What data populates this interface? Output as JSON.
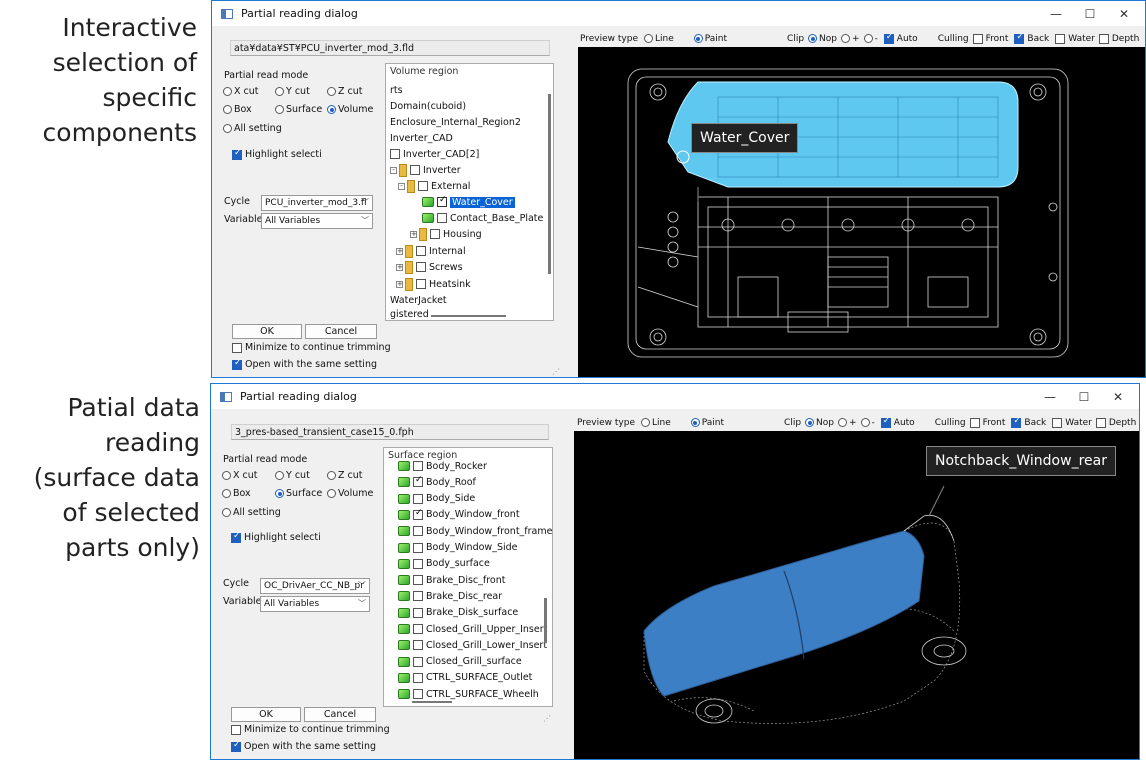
{
  "captions": {
    "top": "Interactive\nselection of\nspecific\ncomponents",
    "bottom": "Patial data\nreading\n(surface data\nof selected\nparts only)"
  },
  "window_controls": {
    "minimize": "—",
    "maximize": "☐",
    "close": "✕"
  },
  "dialog1": {
    "title": "Partial reading dialog",
    "file_path": "ata¥data¥ST¥PCU_inverter_mod_3.fld",
    "read_mode_label": "Partial read mode",
    "modes": [
      {
        "label": "X cut",
        "selected": false
      },
      {
        "label": "Y cut",
        "selected": false
      },
      {
        "label": "Z cut",
        "selected": false
      },
      {
        "label": "Box",
        "selected": false
      },
      {
        "label": "Surface",
        "selected": false
      },
      {
        "label": "Volume",
        "selected": true
      }
    ],
    "all_setting_label": "All setting",
    "highlight_label": "Highlight selecti",
    "cycle_label": "Cycle",
    "cycle_value": "PCU_inverter_mod_3.fl",
    "variable_label": "Variable",
    "variable_value": "All Variables",
    "tree_header": "Volume region",
    "tree_items": [
      {
        "label": "rts",
        "type": "text",
        "indent": 0,
        "checked": false
      },
      {
        "label": "Domain(cuboid)",
        "type": "text",
        "indent": 0,
        "checked": false
      },
      {
        "label": "Enclosure_Internal_Region2",
        "type": "text",
        "indent": 0,
        "checked": false
      },
      {
        "label": "Inverter_CAD",
        "type": "text",
        "indent": 0,
        "checked": false
      },
      {
        "label": "Inverter_CAD[2]",
        "type": "check",
        "indent": 0,
        "checked": false
      },
      {
        "label": "Inverter",
        "type": "folder",
        "indent": 1,
        "checked": false
      },
      {
        "label": "External",
        "type": "folder",
        "indent": 2,
        "checked": false
      },
      {
        "label": "Water_Cover",
        "type": "part",
        "indent": 3,
        "checked": true,
        "selected": true
      },
      {
        "label": "Contact_Base_Plate",
        "type": "part",
        "indent": 3,
        "checked": false
      },
      {
        "label": "Housing",
        "type": "folder",
        "indent": 2,
        "checked": false
      },
      {
        "label": "Internal",
        "type": "folder",
        "indent": 1,
        "checked": false
      },
      {
        "label": "Screws",
        "type": "folder",
        "indent": 1,
        "checked": false
      },
      {
        "label": "Heatsink",
        "type": "folder",
        "indent": 1,
        "checked": false
      },
      {
        "label": "WaterJacket",
        "type": "text",
        "indent": 0,
        "checked": false
      },
      {
        "label": "gistered",
        "type": "text",
        "indent": 0,
        "checked": false
      }
    ],
    "ok_label": "OK",
    "cancel_label": "Cancel",
    "minimize_label": "Minimize to continue trimming",
    "minimize_checked": false,
    "same_setting_label": "Open with the same setting",
    "same_setting_checked": true,
    "callout": "Water_Cover"
  },
  "dialog2": {
    "title": "Partial reading dialog",
    "file_path": "3_pres-based_transient_case15_0.fph",
    "read_mode_label": "Partial read mode",
    "modes": [
      {
        "label": "X cut",
        "selected": false
      },
      {
        "label": "Y cut",
        "selected": false
      },
      {
        "label": "Z cut",
        "selected": false
      },
      {
        "label": "Box",
        "selected": false
      },
      {
        "label": "Surface",
        "selected": true
      },
      {
        "label": "Volume",
        "selected": false
      }
    ],
    "all_setting_label": "All setting",
    "highlight_label": "Highlight selecti",
    "cycle_label": "Cycle",
    "cycle_value": "OC_DrivAer_CC_NB_pr",
    "variable_label": "Variable",
    "variable_value": "All Variables",
    "tree_header": "Surface region",
    "tree_items": [
      {
        "label": "Body_Rocker",
        "checked": false
      },
      {
        "label": "Body_Roof",
        "checked": true
      },
      {
        "label": "Body_Side",
        "checked": false
      },
      {
        "label": "Body_Window_front",
        "checked": true
      },
      {
        "label": "Body_Window_front_frame",
        "checked": false
      },
      {
        "label": "Body_Window_Side",
        "checked": false
      },
      {
        "label": "Body_surface",
        "checked": false
      },
      {
        "label": "Brake_Disc_front",
        "checked": false
      },
      {
        "label": "Brake_Disc_rear",
        "checked": false
      },
      {
        "label": "Brake_Disk_surface",
        "checked": false
      },
      {
        "label": "Closed_Grill_Upper_Insert",
        "checked": false
      },
      {
        "label": "Closed_Grill_Lower_Insert",
        "checked": false
      },
      {
        "label": "Closed_Grill_surface",
        "checked": false
      },
      {
        "label": "CTRL_SURFACE_Outlet",
        "checked": false
      },
      {
        "label": "CTRL_SURFACE_Wheelh",
        "checked": false
      }
    ],
    "ok_label": "OK",
    "cancel_label": "Cancel",
    "minimize_label": "Minimize to continue trimming",
    "minimize_checked": false,
    "same_setting_label": "Open with the same setting",
    "same_setting_checked": true,
    "callout": "Notchback_Window_rear"
  },
  "toolbar": {
    "preview_type_label": "Preview type",
    "line_label": "Line",
    "paint_label": "Paint",
    "clip_label": "Clip",
    "nop_label": "Nop",
    "plus_label": "+",
    "minus_label": "-",
    "auto_label": "Auto",
    "culling_label": "Culling",
    "front_label": "Front",
    "back_label": "Back",
    "water_label": "Water",
    "depth_label": "Depth"
  },
  "colors": {
    "accent": "#1f5fbf",
    "highlight_cyan": "#5ec8f0",
    "car_blue": "#3d7fc4",
    "titlebar_border": "#1e78d6"
  }
}
